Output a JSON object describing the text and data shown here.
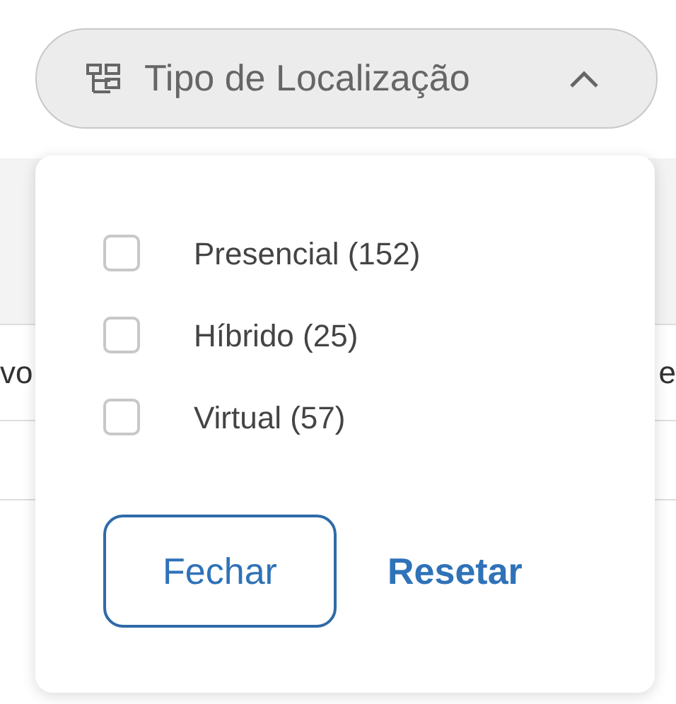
{
  "filter_button": {
    "label": "Tipo de Localização",
    "expanded": true
  },
  "background": {
    "left_fragment": "vo",
    "right_fragment": "e"
  },
  "options": [
    {
      "label": "Presencial (152)",
      "checked": false
    },
    {
      "label": "Híbrido (25)",
      "checked": false
    },
    {
      "label": "Virtual (57)",
      "checked": false
    }
  ],
  "buttons": {
    "close": "Fechar",
    "reset": "Resetar"
  }
}
